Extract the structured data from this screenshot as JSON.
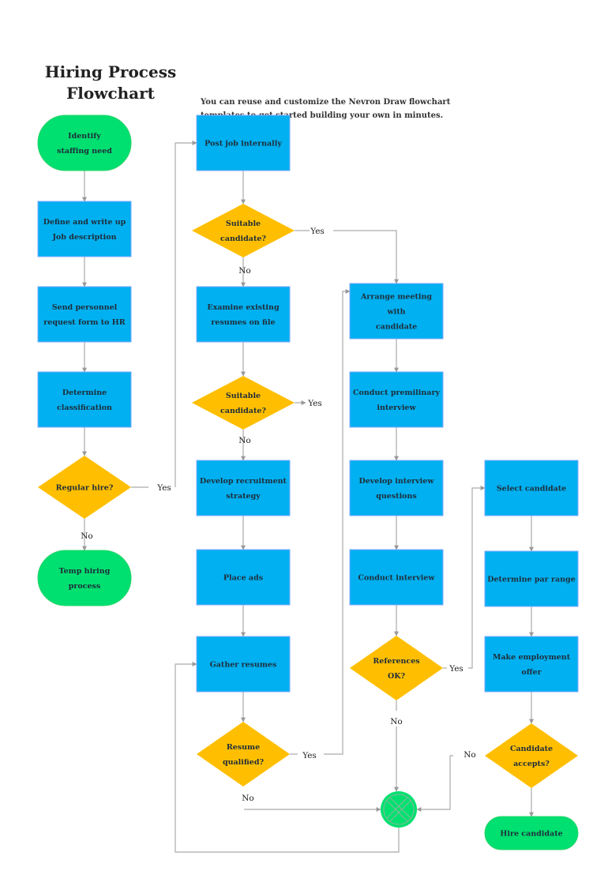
{
  "header": {
    "title_line1": "Hiring Process",
    "title_line2": "Flowchart",
    "subtitle_line1": "You can reuse and customize the Nevron Draw  flowchart",
    "subtitle_line2": "templates to get  started building your own in minutes."
  },
  "colors": {
    "terminal": "#00e070",
    "process": "#00b0f0",
    "process_border": "#7fa8ff",
    "decision": "#ffbf00",
    "connector": "#aaaaaa",
    "arrow": "#999999"
  },
  "nodes": {
    "identify": {
      "type": "terminal",
      "lines": [
        "Identify",
        "staffing need"
      ]
    },
    "define": {
      "type": "process",
      "lines": [
        "Define and write up",
        "Job description"
      ]
    },
    "send": {
      "type": "process",
      "lines": [
        "Send personnel",
        "request form to HR"
      ]
    },
    "classify": {
      "type": "process",
      "lines": [
        "Determine",
        "classification"
      ]
    },
    "regular": {
      "type": "decision",
      "lines": [
        "Regular hire?"
      ]
    },
    "temp": {
      "type": "terminal",
      "lines": [
        "Temp hiring",
        "process"
      ]
    },
    "post": {
      "type": "process",
      "lines": [
        "Post job internally"
      ]
    },
    "suitable1": {
      "type": "decision",
      "lines": [
        "Suitable",
        "candidate?"
      ]
    },
    "examine": {
      "type": "process",
      "lines": [
        "Examine existing",
        "resumes on file"
      ]
    },
    "suitable2": {
      "type": "decision",
      "lines": [
        "Suitable",
        "candidate?"
      ]
    },
    "develop_strategy": {
      "type": "process",
      "lines": [
        "Develop recruitment",
        "strategy"
      ]
    },
    "place_ads": {
      "type": "process",
      "lines": [
        "Place ads"
      ]
    },
    "gather": {
      "type": "process",
      "lines": [
        "Gather resumes"
      ]
    },
    "qualified": {
      "type": "decision",
      "lines": [
        "Resume",
        "qualified?"
      ]
    },
    "arrange": {
      "type": "process",
      "lines": [
        "Arrange meeting",
        "with",
        "candidate"
      ]
    },
    "prelim": {
      "type": "process",
      "lines": [
        "Conduct premilinary",
        "interview"
      ]
    },
    "questions": {
      "type": "process",
      "lines": [
        "Develop interview",
        "questions"
      ]
    },
    "interview": {
      "type": "process",
      "lines": [
        "Conduct interview"
      ]
    },
    "references": {
      "type": "decision",
      "lines": [
        "References",
        "OK?"
      ]
    },
    "select": {
      "type": "process",
      "lines": [
        "Select candidate"
      ]
    },
    "pay": {
      "type": "process",
      "lines": [
        "Determine par range"
      ]
    },
    "offer": {
      "type": "process",
      "lines": [
        "Make employment",
        "offer"
      ]
    },
    "accepts": {
      "type": "decision",
      "lines": [
        "Candidate",
        "accepts?"
      ]
    },
    "hire": {
      "type": "terminal",
      "lines": [
        "Hire candidate"
      ]
    },
    "merge": {
      "type": "merge",
      "lines": []
    }
  },
  "edges": [
    {
      "from": "identify",
      "to": "define",
      "label": ""
    },
    {
      "from": "define",
      "to": "send",
      "label": ""
    },
    {
      "from": "send",
      "to": "classify",
      "label": ""
    },
    {
      "from": "classify",
      "to": "regular",
      "label": ""
    },
    {
      "from": "regular",
      "to": "temp",
      "label": "No"
    },
    {
      "from": "regular",
      "to": "post",
      "label": "Yes"
    },
    {
      "from": "post",
      "to": "suitable1",
      "label": ""
    },
    {
      "from": "suitable1",
      "to": "examine",
      "label": "No"
    },
    {
      "from": "suitable1",
      "to": "arrange",
      "label": "Yes"
    },
    {
      "from": "examine",
      "to": "suitable2",
      "label": ""
    },
    {
      "from": "suitable2",
      "to": "develop_strategy",
      "label": "No"
    },
    {
      "from": "suitable2",
      "to": "arrange",
      "label": "Yes"
    },
    {
      "from": "develop_strategy",
      "to": "place_ads",
      "label": ""
    },
    {
      "from": "place_ads",
      "to": "gather",
      "label": ""
    },
    {
      "from": "gather",
      "to": "qualified",
      "label": ""
    },
    {
      "from": "qualified",
      "to": "arrange",
      "label": "Yes"
    },
    {
      "from": "qualified",
      "to": "merge",
      "label": "No"
    },
    {
      "from": "arrange",
      "to": "prelim",
      "label": ""
    },
    {
      "from": "prelim",
      "to": "questions",
      "label": ""
    },
    {
      "from": "questions",
      "to": "interview",
      "label": ""
    },
    {
      "from": "interview",
      "to": "references",
      "label": ""
    },
    {
      "from": "references",
      "to": "select",
      "label": "Yes"
    },
    {
      "from": "references",
      "to": "merge",
      "label": "No"
    },
    {
      "from": "select",
      "to": "pay",
      "label": ""
    },
    {
      "from": "pay",
      "to": "offer",
      "label": ""
    },
    {
      "from": "offer",
      "to": "accepts",
      "label": ""
    },
    {
      "from": "accepts",
      "to": "hire",
      "label": ""
    },
    {
      "from": "accepts",
      "to": "merge",
      "label": "No"
    },
    {
      "from": "merge",
      "to": "gather",
      "label": ""
    }
  ]
}
